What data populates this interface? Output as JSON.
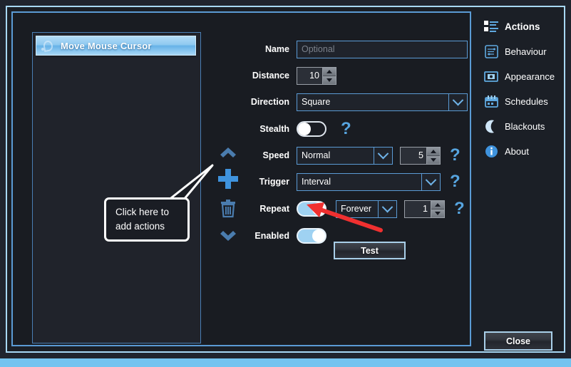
{
  "window": {
    "actions_list": {
      "items": [
        {
          "label": "Move Mouse Cursor",
          "icon": "mouse-cursor-icon",
          "selected": true
        }
      ]
    },
    "toolbar": {
      "move_up": "chevron-up-icon",
      "add": "plus-icon",
      "delete": "trash-icon",
      "move_down": "chevron-down-icon"
    },
    "form": {
      "name": {
        "label": "Name",
        "value": "",
        "placeholder": "Optional"
      },
      "distance": {
        "label": "Distance",
        "value": "10"
      },
      "direction": {
        "label": "Direction",
        "value": "Square"
      },
      "stealth": {
        "label": "Stealth",
        "state": "off",
        "help": "?"
      },
      "speed": {
        "label": "Speed",
        "value": "Normal",
        "number": "5",
        "help": "?"
      },
      "trigger": {
        "label": "Trigger",
        "value": "Interval",
        "help": "?"
      },
      "repeat": {
        "label": "Repeat",
        "state": "on",
        "mode": "Forever",
        "number": "1",
        "help": "?"
      },
      "enabled": {
        "label": "Enabled",
        "state": "on"
      }
    },
    "test_button": "Test",
    "close_button": "Close",
    "callout": {
      "line1": "Click here to",
      "line2": "add actions"
    }
  },
  "nav": {
    "items": [
      {
        "label": "Actions",
        "icon": "list-icon",
        "active": true
      },
      {
        "label": "Behaviour",
        "icon": "behaviour-icon",
        "active": false
      },
      {
        "label": "Appearance",
        "icon": "appearance-icon",
        "active": false
      },
      {
        "label": "Schedules",
        "icon": "calendar-icon",
        "active": false
      },
      {
        "label": "Blackouts",
        "icon": "moon-icon",
        "active": false
      },
      {
        "label": "About",
        "icon": "info-icon",
        "active": false
      }
    ]
  },
  "colors": {
    "accent": "#5b9bd5",
    "icon_blue": "#6fb3e8",
    "bright_blue": "#4aa3e8",
    "arrow_red": "#f03030",
    "background": "#1b1f26",
    "strip": "#74c3ef"
  }
}
